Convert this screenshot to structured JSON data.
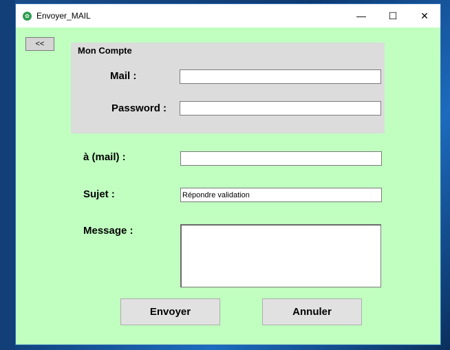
{
  "window": {
    "title": "Envoyer_MAIL",
    "minimize_glyph": "—",
    "maximize_glyph": "☐",
    "close_glyph": "✕"
  },
  "back_button": {
    "label": "<<"
  },
  "account_group": {
    "title": "Mon Compte",
    "mail_label": "Mail :",
    "mail_value": "",
    "password_label": "Password :",
    "password_value": ""
  },
  "form": {
    "to_label": "à (mail) :",
    "to_value": "",
    "subject_label": "Sujet :",
    "subject_value": "Répondre validation",
    "message_label": "Message :",
    "message_value": ""
  },
  "buttons": {
    "send_label": "Envoyer",
    "cancel_label": "Annuler"
  },
  "colors": {
    "window_bg": "#c0ffc0",
    "group_bg": "#dcdcdc",
    "button_bg": "#e1e1e1"
  }
}
